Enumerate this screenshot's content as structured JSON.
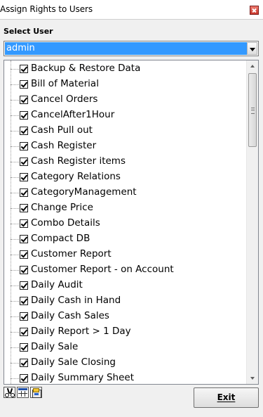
{
  "window": {
    "title": "Assign Rights to Users"
  },
  "select_user": {
    "label": "Select User",
    "selected": "admin"
  },
  "rights": [
    {
      "label": "Backup & Restore Data",
      "checked": true
    },
    {
      "label": "Bill of Material",
      "checked": true
    },
    {
      "label": "Cancel Orders",
      "checked": true
    },
    {
      "label": "CancelAfter1Hour",
      "checked": true
    },
    {
      "label": "Cash Pull out",
      "checked": true
    },
    {
      "label": "Cash Register",
      "checked": true
    },
    {
      "label": "Cash Register items",
      "checked": true
    },
    {
      "label": "Category Relations",
      "checked": true
    },
    {
      "label": "CategoryManagement",
      "checked": true
    },
    {
      "label": "Change Price",
      "checked": true
    },
    {
      "label": "Combo Details",
      "checked": true
    },
    {
      "label": "Compact DB",
      "checked": true
    },
    {
      "label": "Customer Report",
      "checked": true
    },
    {
      "label": "Customer Report - on Account",
      "checked": true
    },
    {
      "label": "Daily Audit",
      "checked": true
    },
    {
      "label": "Daily Cash in Hand",
      "checked": true
    },
    {
      "label": "Daily Cash Sales",
      "checked": true
    },
    {
      "label": "Daily Report > 1 Day",
      "checked": true
    },
    {
      "label": "Daily Sale",
      "checked": true
    },
    {
      "label": "Daily Sale Closing",
      "checked": true
    },
    {
      "label": "Daily Summary Sheet",
      "checked": true
    }
  ],
  "toolbar": {
    "icons": [
      "scissors-icon",
      "table-view-icon",
      "report-icon"
    ]
  },
  "exit_button": {
    "label": "Exit"
  }
}
